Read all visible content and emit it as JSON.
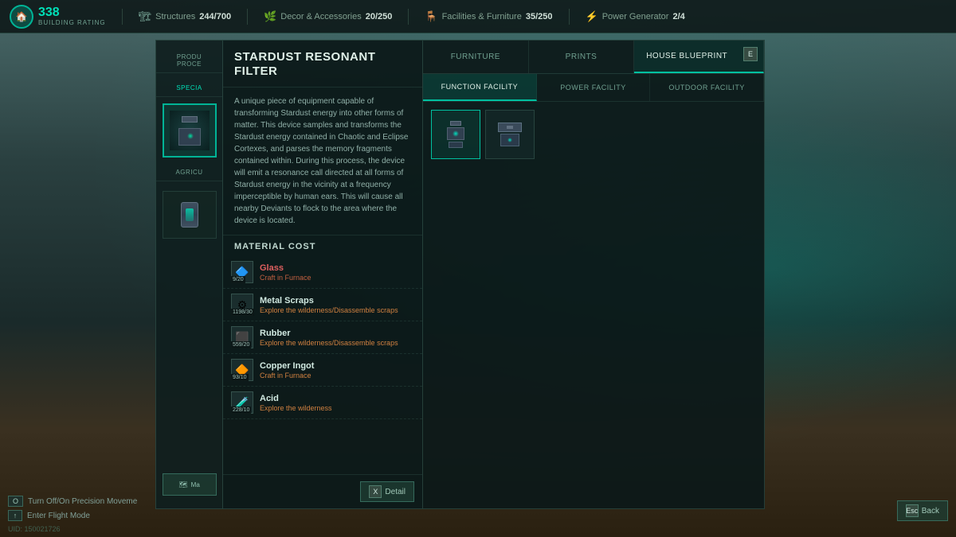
{
  "hud": {
    "building_rating": "338",
    "rating_label": "BUILDING RATING",
    "stats": [
      {
        "icon": "🏠",
        "name": "Structures",
        "value": "244/700"
      },
      {
        "icon": "🪴",
        "name": "Decor & Accessories",
        "value": "20/250"
      },
      {
        "icon": "🪑",
        "name": "Facilities & Furniture",
        "value": "35/250"
      },
      {
        "icon": "⚡",
        "name": "Power Generator",
        "value": "2/4"
      }
    ]
  },
  "item": {
    "title": "STARDUST RESONANT FILTER",
    "description": "A unique piece of equipment capable of transforming Stardust energy into other forms of matter. This device samples and transforms the Stardust energy contained in Chaotic and Eclipse Cortexes, and parses the memory fragments contained within. During this process, the device will emit a resonance call directed at all forms of Stardust energy in the vicinity at a frequency imperceptible by human ears. This will cause all nearby Deviants to flock to the area where the device is located."
  },
  "material_cost": {
    "header": "MATERIAL COST",
    "materials": [
      {
        "name": "Glass",
        "qty": "9/20",
        "source": "Craft in Furnace",
        "insufficient": true,
        "source_color": "red"
      },
      {
        "name": "Metal Scraps",
        "qty": "1198/30",
        "source": "Explore the wilderness/Disassemble scraps",
        "insufficient": false,
        "source_color": "orange"
      },
      {
        "name": "Rubber",
        "qty": "559/20",
        "source": "Explore the wilderness/Disassemble scraps",
        "insufficient": false,
        "source_color": "orange"
      },
      {
        "name": "Copper Ingot",
        "qty": "93/10",
        "source": "Craft in Furnace",
        "insufficient": false,
        "source_color": "orange"
      },
      {
        "name": "Acid",
        "qty": "228/10",
        "source": "Explore the wilderness",
        "insufficient": false,
        "source_color": "orange"
      }
    ]
  },
  "tabs_top": [
    {
      "label": "FURNITURE",
      "active": false
    },
    {
      "label": "PRINTS",
      "active": false
    },
    {
      "label": "HOUSE BLUEPRINT",
      "active": false
    }
  ],
  "tabs_sub": [
    {
      "label": "FUNCTION FACILITY",
      "active": true
    },
    {
      "label": "POWER FACILITY",
      "active": false
    },
    {
      "label": "OUTDOOR FACILITY",
      "active": false
    }
  ],
  "sidebar_sections": [
    {
      "label": "PRODU PROCE"
    },
    {
      "label": "SPECIA"
    },
    {
      "label": "AGRICU"
    }
  ],
  "controls": [
    {
      "key": "O",
      "label": "Turn Off/On Precision Moveme"
    },
    {
      "key": "↑",
      "label": "Enter Flight Mode"
    }
  ],
  "footer": {
    "esc_key": "Esc",
    "esc_label": "Back",
    "x_key": "X",
    "detail_label": "Detail"
  },
  "uid": "UID: 150021726"
}
